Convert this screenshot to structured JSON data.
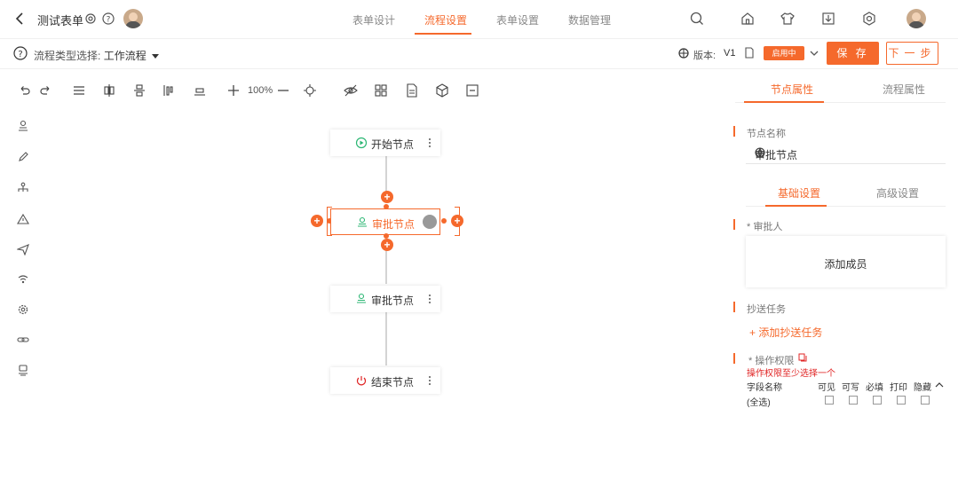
{
  "header": {
    "form_title": "测试表单",
    "tabs": [
      "表单设计",
      "流程设置",
      "表单设置",
      "数据管理"
    ],
    "active_tab": 1
  },
  "subbar": {
    "flow_type_label": "流程类型选择:",
    "flow_type_value": "工作流程",
    "version_label": "版本:",
    "version_value": "V1",
    "status": "启用中",
    "save": "保 存",
    "next": "下一步"
  },
  "toolbar": {
    "zoom": "100%"
  },
  "canvas": {
    "nodes": [
      {
        "label": "开始节点",
        "icon": "play-circle-icon"
      },
      {
        "label": "审批节点",
        "icon": "approver-icon"
      },
      {
        "label": "审批节点",
        "icon": "approver-icon"
      },
      {
        "label": "结束节点",
        "icon": "power-icon"
      }
    ]
  },
  "panel": {
    "tabs": [
      "节点属性",
      "流程属性"
    ],
    "node_name_title": "节点名称",
    "node_name_value": "审批节点",
    "sub_tabs": [
      "基础设置",
      "高级设置"
    ],
    "approver_title": "* 审批人",
    "add_member": "添加成员",
    "cc_title": "抄送任务",
    "add_cc": "+ 添加抄送任务",
    "perm_title": "* 操作权限",
    "perm_warning": "操作权限至少选择一个",
    "perm_headers": [
      "字段名称",
      "可见",
      "可写",
      "必填",
      "打印",
      "隐藏"
    ],
    "perm_row": "(全选)"
  },
  "colors": {
    "accent": "#f5692c",
    "start_green": "#2bb673",
    "end_red": "#e02424"
  }
}
